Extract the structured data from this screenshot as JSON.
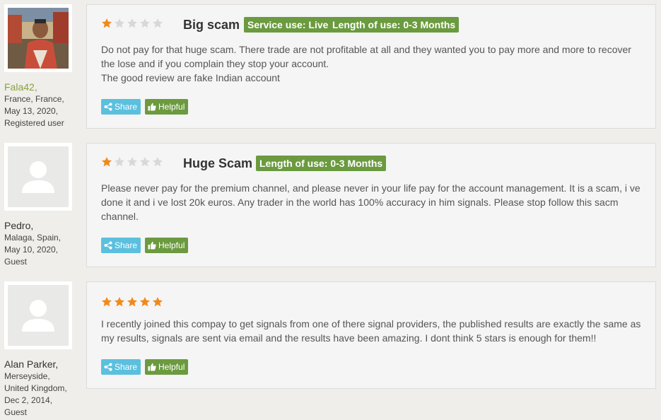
{
  "reviews": [
    {
      "user": {
        "name": "Fala42",
        "location": "France, France,",
        "date": "May 13, 2020,",
        "type": "Registered user"
      },
      "rating": 1,
      "title": "Big scam",
      "tags": [
        "Service use: Live",
        "Length of use: 0-3 Months"
      ],
      "lines": [
        "Do not pay for that huge scam. There trade are not profitable at all and they wanted you to pay more and more to recover",
        "the lose and if you complain they stop your account.",
        "The good review are fake Indian account"
      ],
      "share_label": "Share",
      "helpful_label": "Helpful"
    },
    {
      "user": {
        "name": "Pedro,",
        "location": "Malaga, Spain,",
        "date": "May 10, 2020,",
        "type": "Guest"
      },
      "rating": 1,
      "title": "Huge Scam",
      "tags": [
        "Length of use: 0-3 Months"
      ],
      "lines": [
        "Please never pay for the premium channel, and please never in your life pay for the account management. It is a scam, i ve",
        "done it and i ve lost 20k euros. Any trader in the world has 100% accuracy in him signals. Please stop follow this sacm",
        "channel."
      ],
      "share_label": "Share",
      "helpful_label": "Helpful"
    },
    {
      "user": {
        "name": "Alan Parker,",
        "location": "Merseyside,",
        "location2": "United Kingdom,",
        "date": "Dec 2, 2014,",
        "type": "Guest"
      },
      "rating": 5,
      "title": "",
      "tags": [],
      "lines": [
        "I recently joined this compay to get signals from one of there signal providers, the published results are exactly the same as",
        "my results, signals are sent via email and the results have been amazing. I dont think 5 stars is enough for them!!"
      ],
      "share_label": "Share",
      "helpful_label": "Helpful"
    }
  ],
  "colors": {
    "star_on": "#f08a1c",
    "star_off": "#d8d8d8",
    "tag": "#6b9a3f",
    "share": "#5bc0de",
    "username_link": "#8aa23c"
  }
}
